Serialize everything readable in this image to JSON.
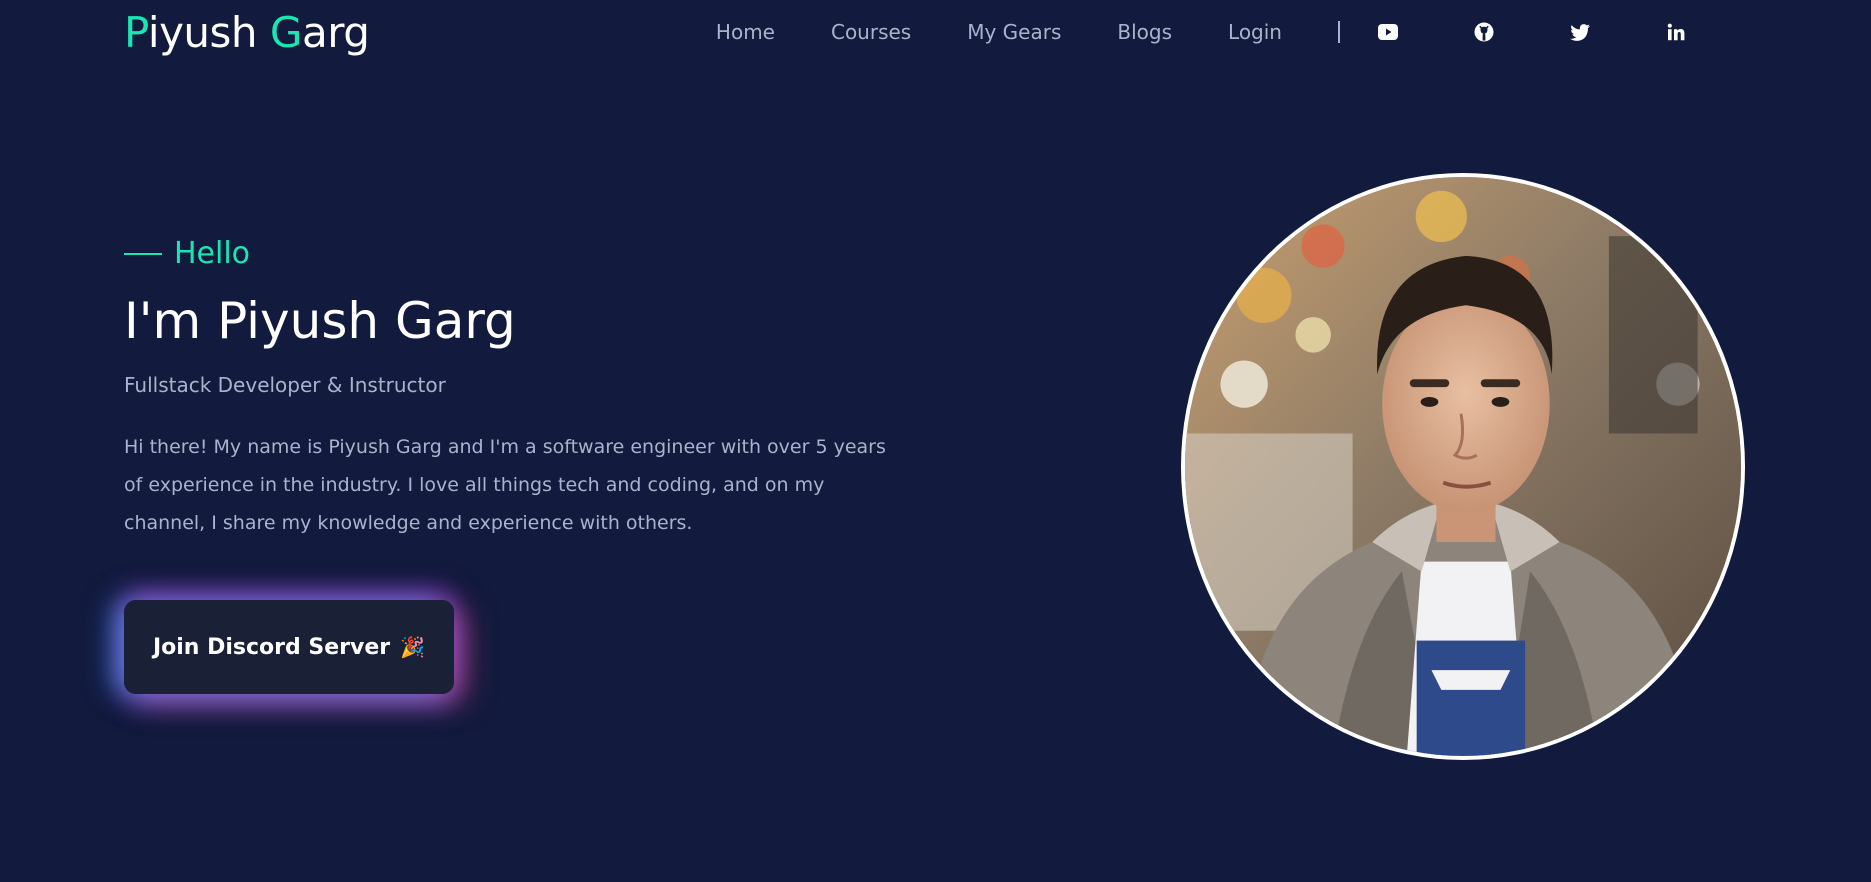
{
  "header": {
    "logo_first_initial": "P",
    "logo_first_rest": "iyush ",
    "logo_last_initial": "G",
    "logo_last_rest": "arg",
    "nav": [
      "Home",
      "Courses",
      "My Gears",
      "Blogs",
      "Login"
    ],
    "social_icons": [
      "youtube-icon",
      "github-icon",
      "twitter-icon",
      "linkedin-icon"
    ]
  },
  "hero": {
    "hello": "Hello",
    "title": "I'm Piyush Garg",
    "subtitle": "Fullstack Developer & Instructor",
    "bio": "Hi there! My name is Piyush Garg and I'm a software engineer with over 5 years of experience in the industry. I love all things tech and coding, and on my channel, I share my knowledge and experience with others.",
    "cta_label": "Join Discord Server",
    "cta_emoji": "🎉"
  },
  "colors": {
    "background": "#121a3d",
    "accent": "#19e6b2",
    "muted_text": "#aab3cc",
    "button_bg": "#1a2035"
  }
}
